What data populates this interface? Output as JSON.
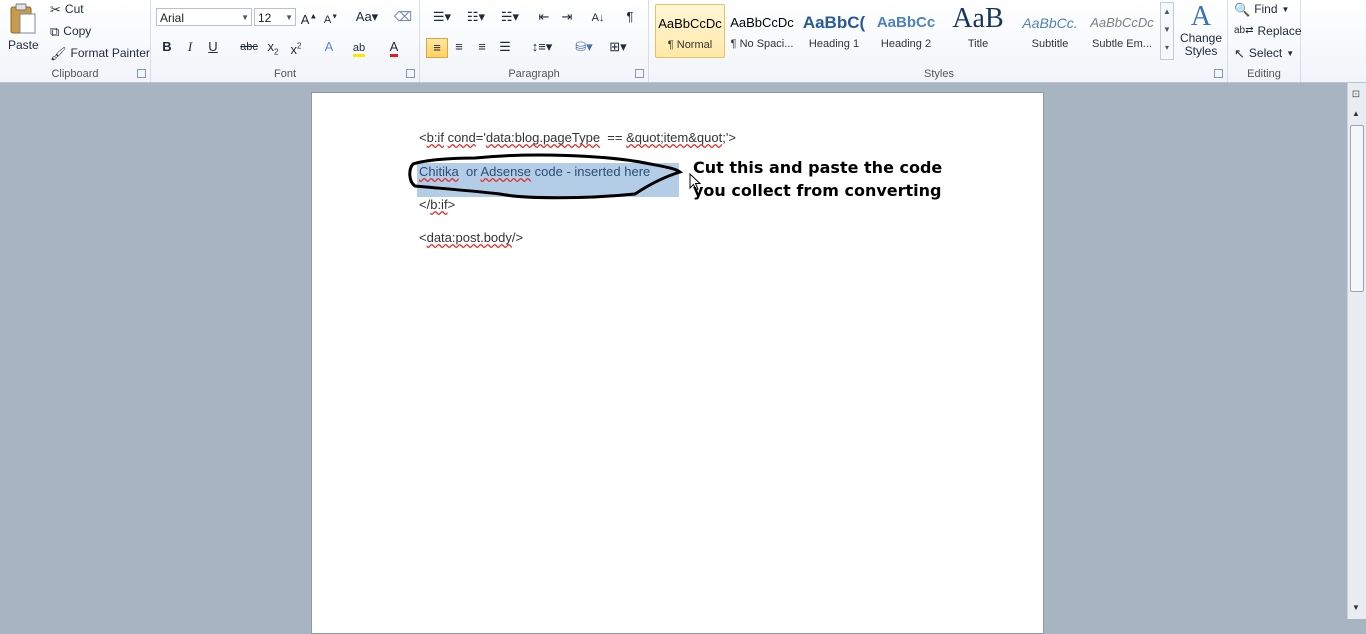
{
  "ribbon": {
    "clipboard": {
      "label": "Clipboard",
      "paste": "Paste",
      "cut": "Cut",
      "copy": "Copy",
      "format_painter": "Format Painter"
    },
    "font": {
      "label": "Font",
      "family": "Arial",
      "size": "12"
    },
    "paragraph": {
      "label": "Paragraph"
    },
    "styles": {
      "label": "Styles",
      "items": [
        {
          "sample": "AaBbCcDc",
          "name": "¶ Normal"
        },
        {
          "sample": "AaBbCcDc",
          "name": "¶ No Spaci..."
        },
        {
          "sample": "AaBbC(",
          "name": "Heading 1"
        },
        {
          "sample": "AaBbCc",
          "name": "Heading 2"
        },
        {
          "sample": "AaB",
          "name": "Title"
        },
        {
          "sample": "AaBbCc.",
          "name": "Subtitle"
        },
        {
          "sample": "AaBbCcDc",
          "name": "Subtle Em..."
        }
      ],
      "change_styles": "Change Styles"
    },
    "editing": {
      "label": "Editing",
      "find": "Find",
      "replace": "Replace",
      "select": "Select"
    }
  },
  "document": {
    "line1_a": "<",
    "line1_b": "b:if",
    "line1_c": " ",
    "line1_d": "cond",
    "line1_e": "='",
    "line1_f": "data:blog.pageType",
    "line1_g": "  == ",
    "line1_h": "&quot;item&quot",
    "line1_i": ";'>",
    "line2_a": "Chitika",
    "line2_b": "  or ",
    "line2_c": "Adsense",
    "line2_d": " code - inserted here",
    "line3_a": "</",
    "line3_b": "b:if",
    "line3_c": ">",
    "line4_a": "<",
    "line4_b": "data:post.body",
    "line4_c": "/>"
  },
  "annotation": {
    "line1": "Cut this and paste the code",
    "line2": "you collect from converting"
  }
}
